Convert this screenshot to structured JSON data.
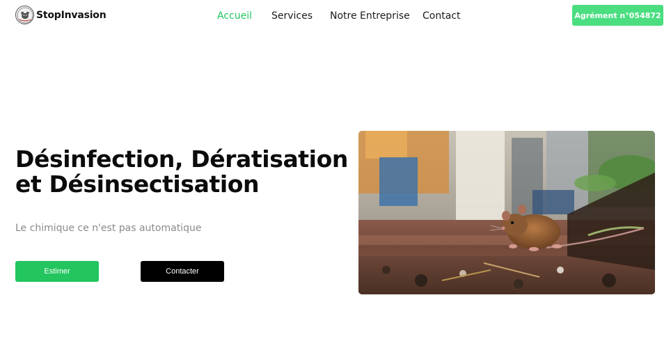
{
  "brand": {
    "name": "StopInvasion",
    "logo_icon": "rat-badge-icon"
  },
  "nav": {
    "items": [
      {
        "label": "Accueil",
        "active": true
      },
      {
        "label": "Services",
        "active": false
      },
      {
        "label": "Notre Entreprise",
        "active": false
      },
      {
        "label": "Contact",
        "active": false
      }
    ]
  },
  "header_badge": {
    "label": "Agrément n°054872"
  },
  "hero": {
    "title_line1": "Désinfection, Dératisation",
    "title_line2": "et Désinsectisation",
    "subtitle": "Le chimique ce n'est pas automatique",
    "primary_button": "Estimer",
    "secondary_button": "Contacter",
    "image_subject": "rat-on-ground-photo"
  },
  "colors": {
    "accent": "#22c55e",
    "badge": "#4ade80",
    "dark_button": "#000000",
    "subtitle": "#8a8a8a"
  }
}
